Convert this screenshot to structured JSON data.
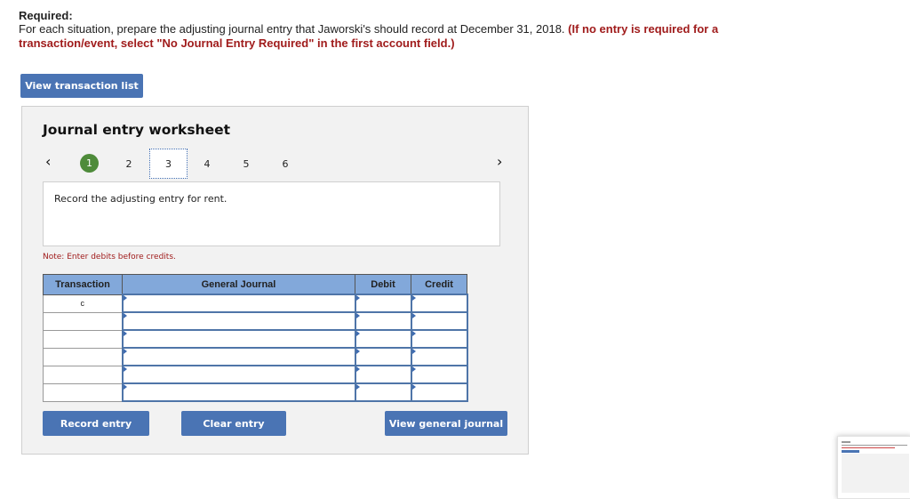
{
  "header": {
    "required_label": "Required:",
    "instruction": "For each situation, prepare the adjusting journal entry that Jaworski's should record at December 31, 2018.",
    "instruction_note": "(If no entry is required for a transaction/event, select \"No Journal Entry Required\" in the first account field.)"
  },
  "buttons": {
    "view_transaction_list": "View transaction list",
    "record_entry": "Record entry",
    "clear_entry": "Clear entry",
    "view_general_journal": "View general journal"
  },
  "worksheet": {
    "title": "Journal entry worksheet",
    "prev_icon": "‹",
    "next_icon": "›",
    "steps": [
      {
        "label": "1",
        "state": "completed"
      },
      {
        "label": "2",
        "state": "normal"
      },
      {
        "label": "3",
        "state": "active"
      },
      {
        "label": "4",
        "state": "normal"
      },
      {
        "label": "5",
        "state": "normal"
      },
      {
        "label": "6",
        "state": "normal"
      }
    ],
    "description": "Record the adjusting entry for rent.",
    "note": "Note: Enter debits before credits."
  },
  "journal_table": {
    "columns": [
      "Transaction",
      "General Journal",
      "Debit",
      "Credit"
    ],
    "rows": [
      {
        "transaction": "c",
        "account": "",
        "debit": "",
        "credit": ""
      },
      {
        "transaction": "",
        "account": "",
        "debit": "",
        "credit": ""
      },
      {
        "transaction": "",
        "account": "",
        "debit": "",
        "credit": ""
      },
      {
        "transaction": "",
        "account": "",
        "debit": "",
        "credit": ""
      },
      {
        "transaction": "",
        "account": "",
        "debit": "",
        "credit": ""
      },
      {
        "transaction": "",
        "account": "",
        "debit": "",
        "credit": ""
      }
    ]
  },
  "colors": {
    "accent_button": "#4a74b4",
    "header_row": "#82a8da",
    "note_red": "#a01c1c",
    "step_done": "#4e8b3a"
  }
}
